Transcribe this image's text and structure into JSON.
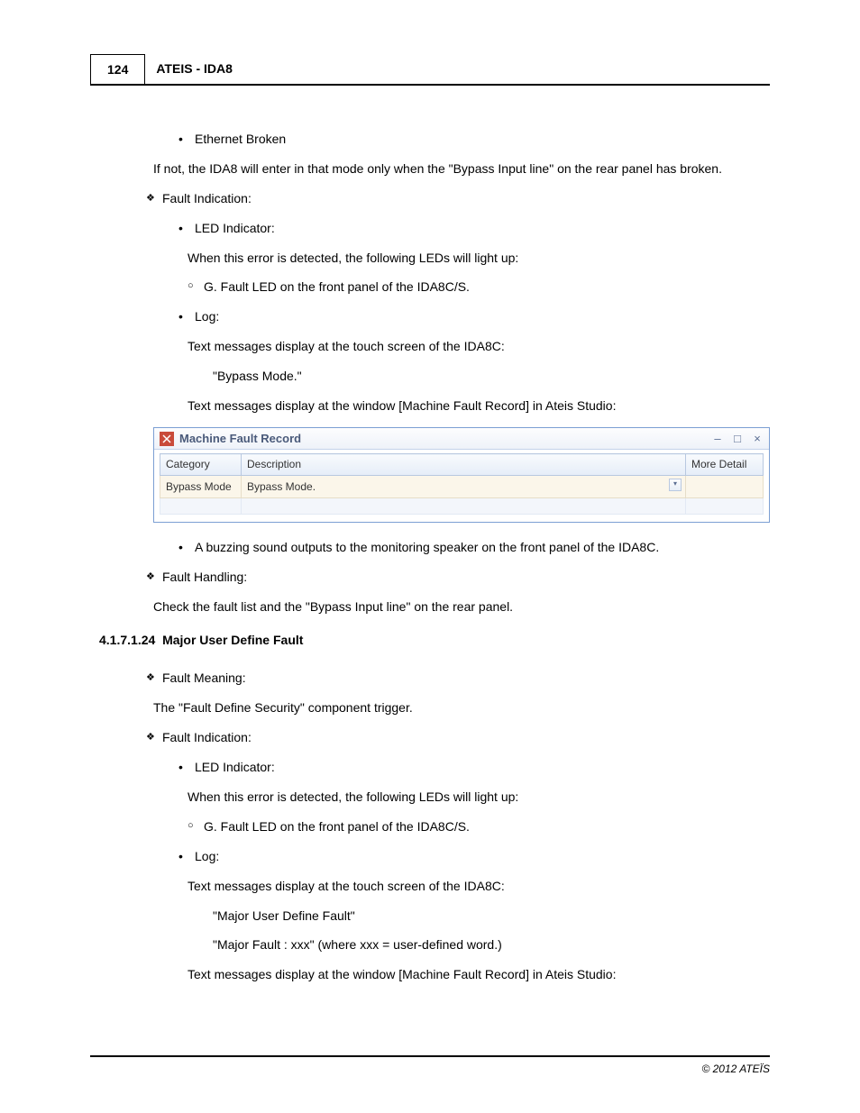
{
  "header": {
    "page_number": "124",
    "title": "ATEIS - IDA8"
  },
  "top": {
    "bullet_ethernet": "Ethernet Broken",
    "if_not": "If  not,  the  IDA8  will  enter  in  that  mode  only  when  the  \"Bypass  Input  line\"  on  the  rear  panel  has broken.",
    "fault_indication": "Fault Indication:",
    "led_indicator": "LED Indicator:",
    "led_text": "When this error is detected, the following LEDs will light up:",
    "led_sub": "G. Fault LED on the front panel of the IDA8C/S.",
    "log": "Log:",
    "log_text1": "Text messages display at the touch screen of the IDA8C:",
    "log_msg1": "\"Bypass Mode.\"",
    "log_text2": "Text messages display at the window [Machine Fault Record] in Ateis Studio:"
  },
  "window": {
    "title": "Machine Fault Record",
    "headers": {
      "category": "Category",
      "description": "Description",
      "more": "More Detail"
    },
    "row": {
      "category": "Bypass Mode",
      "description": "Bypass Mode."
    }
  },
  "mid": {
    "buzz": "A buzzing sound outputs to the monitoring speaker on the front panel of the IDA8C.",
    "fault_handling": "Fault Handling:",
    "fh_text": "Check the fault list and the \"Bypass Input line\" on the rear panel."
  },
  "section": {
    "number": "4.1.7.1.24",
    "title": "Major User Define Fault"
  },
  "bottom": {
    "fault_meaning": "Fault Meaning:",
    "fm_text": "The \"Fault Define Security\" component trigger.",
    "fault_indication": "Fault Indication:",
    "led_indicator": "LED Indicator:",
    "led_text": "When this error is detected, the following LEDs will light up:",
    "led_sub": "G. Fault LED on the front panel of the IDA8C/S.",
    "log": "Log:",
    "log_text1": "Text messages display at the touch screen of the IDA8C:",
    "log_msg1": "\"Major User Define Fault\"",
    "log_msg2": "\"Major Fault : xxx\" (where xxx = user-defined word.)",
    "log_text2": "Text messages display at the window [Machine Fault Record] in Ateis Studio:"
  },
  "footer": "© 2012 ATEÏS"
}
